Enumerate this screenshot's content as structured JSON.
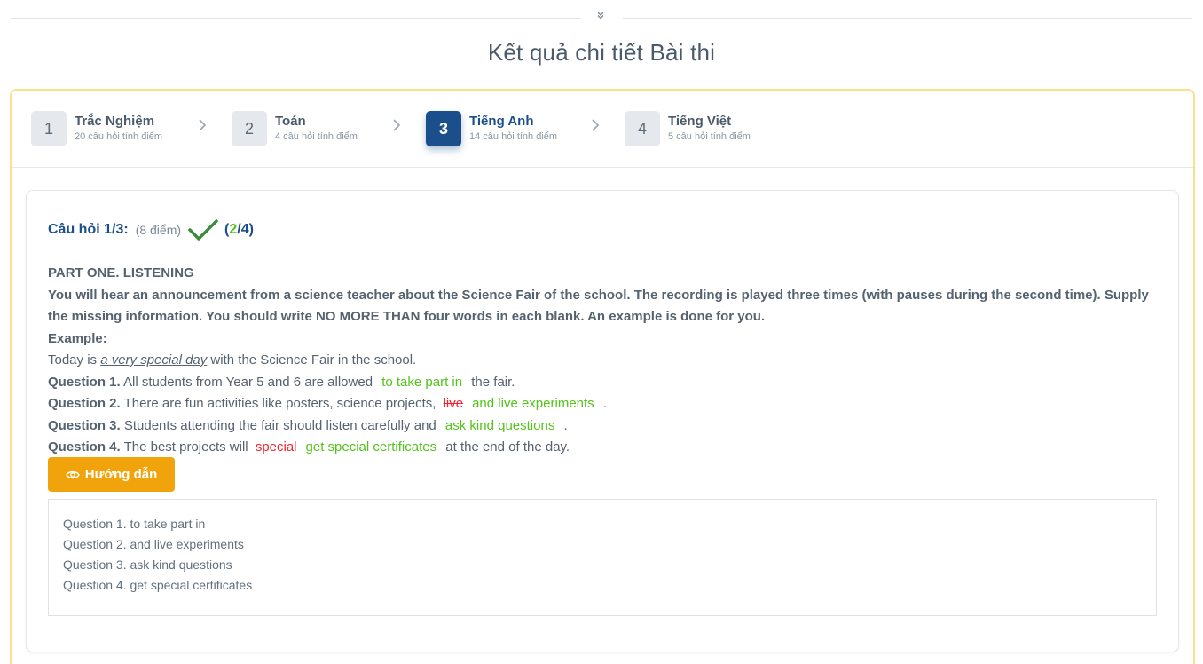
{
  "header": {
    "divider_icon": "double-chevron-down-icon",
    "divider_glyph": "»",
    "title": "Kết quả chi tiết Bài thi"
  },
  "steps": [
    {
      "number": "1",
      "name": "Trắc Nghiệm",
      "sub": "20 câu hỏi tính điểm",
      "active": false
    },
    {
      "number": "2",
      "name": "Toán",
      "sub": "4 câu hỏi tính điểm",
      "active": false
    },
    {
      "number": "3",
      "name": "Tiếng Anh",
      "sub": "14 câu hỏi tính điểm",
      "active": true
    },
    {
      "number": "4",
      "name": "Tiếng Việt",
      "sub": "5 câu hỏi tính điểm",
      "active": false
    }
  ],
  "step_arrow_glyph": "›",
  "question": {
    "title": "Câu hỏi 1/3:",
    "points": "(8 điểm)",
    "status_icon": "checkmark-icon",
    "score_open": "(",
    "score_correct": "2",
    "score_sep_total": "/4)",
    "part_title": "PART ONE. LISTENING",
    "instructions": "You will hear an announcement from a science teacher about the Science Fair of the school. The recording is played three times (with pauses during the second time). Supply the missing information. You should write NO MORE THAN four words in each blank. An example is done for you.",
    "example_label": "Example:",
    "example": {
      "before": "Today is ",
      "answer": "a very special day",
      "after": " with the Science Fair in the school."
    },
    "items": [
      {
        "label": "Question 1.",
        "before": " All students from Year 5 and 6 are allowed ",
        "wrong": "",
        "correct": "to take part in",
        "after": " the fair."
      },
      {
        "label": "Question 2.",
        "before": " There are fun activities like posters, science projects, ",
        "wrong": "live",
        "correct": "and live experiments",
        "after": " ."
      },
      {
        "label": "Question 3.",
        "before": " Students attending the fair should listen carefully and ",
        "wrong": "",
        "correct": "ask kind questions",
        "after": " ."
      },
      {
        "label": "Question 4.",
        "before": " The best projects will ",
        "wrong": "special",
        "correct": "get special certificates",
        "after": " at the end of the day."
      }
    ]
  },
  "guide_button": {
    "label": "Hướng dẫn",
    "icon": "eye-icon"
  },
  "answers": [
    "Question 1. to take part in",
    "Question 2. and live experiments",
    "Question 3. ask kind questions",
    "Question 4. get special certificates"
  ],
  "colors": {
    "accent": "#1b4f8c",
    "correct": "#52c41a",
    "wrong": "#f5222d",
    "button": "#f0a30a",
    "panel_border": "#fde08a"
  }
}
